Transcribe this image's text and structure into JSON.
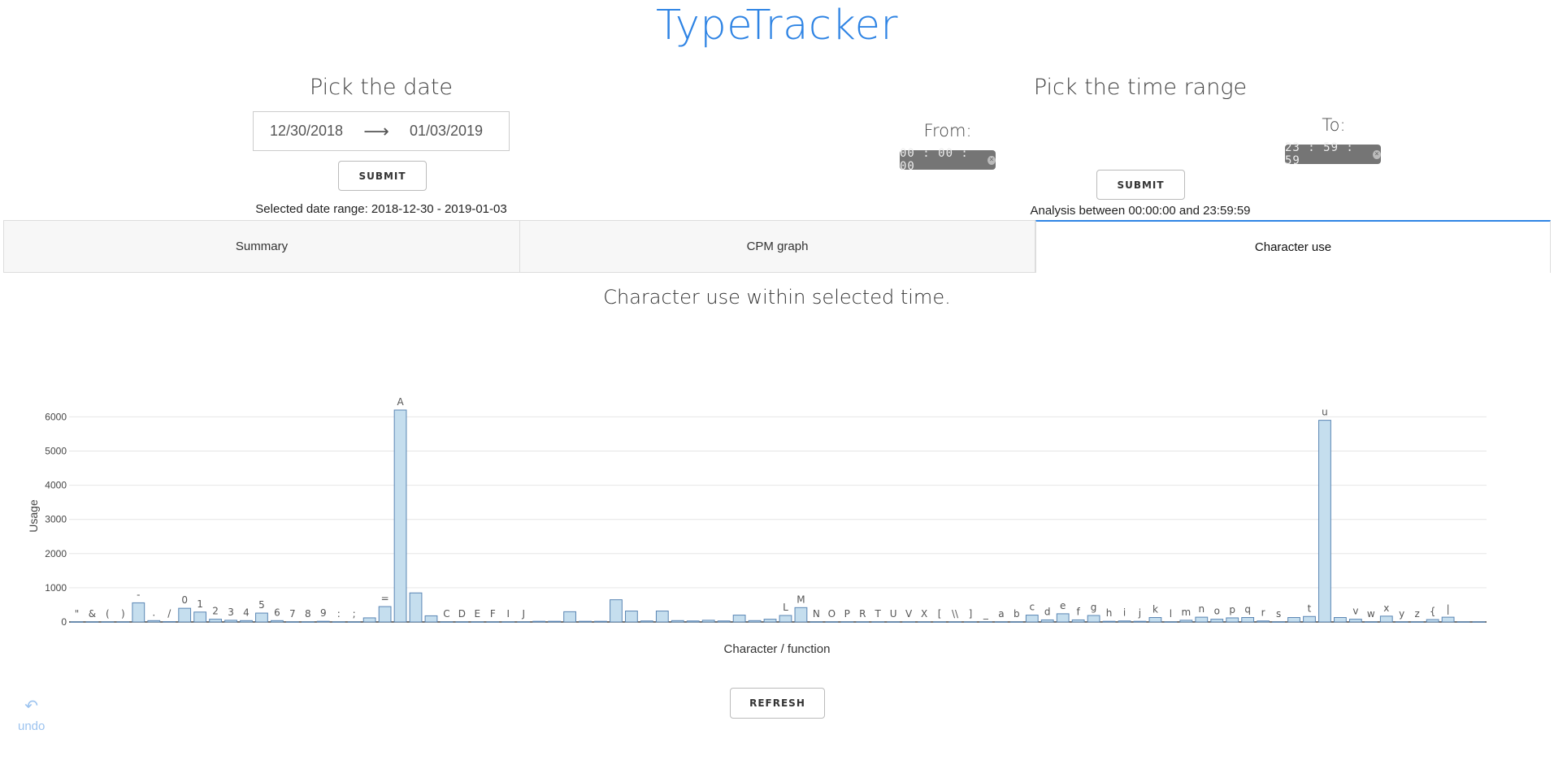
{
  "app": {
    "title": "TypeTracker"
  },
  "date_picker": {
    "heading": "Pick the date",
    "start": "12/30/2018",
    "arrow": "⟶",
    "end": "01/03/2019",
    "submit_label": "SUBMIT",
    "selected_text": "Selected date range: 2018-12-30 - 2019-01-03"
  },
  "time_picker": {
    "heading": "Pick the time range",
    "from_label": "From:",
    "from_value": "00 : 00 : 00",
    "to_label": "To:",
    "to_value": "23 : 59 : 59",
    "clear_icon": "×",
    "submit_label": "SUBMIT",
    "analysis_text": "Analysis between 00:00:00 and 23:59:59"
  },
  "tabs": [
    {
      "label": "Summary",
      "active": false
    },
    {
      "label": "CPM graph",
      "active": false
    },
    {
      "label": "Character use",
      "active": true
    }
  ],
  "refresh_label": "REFRESH",
  "undo": {
    "icon": "undo-icon",
    "glyph": "↶",
    "label": "undo"
  },
  "colors": {
    "accent": "#2f84e4",
    "bar_fill": "#c5deee",
    "bar_stroke": "#5a86b4"
  },
  "chart_data": {
    "type": "bar",
    "title": "Character use within selected time.",
    "xlabel": "Character / function",
    "ylabel": "Usage",
    "ylim": [
      0,
      6200
    ],
    "yticks": [
      0,
      1000,
      2000,
      3000,
      4000,
      5000,
      6000
    ],
    "grid": true,
    "categories": [
      "\"",
      "&",
      "(",
      ")",
      "-",
      ".",
      "/",
      "0",
      "1",
      "2",
      "3",
      "4",
      "5",
      "6",
      "7",
      "8",
      "9",
      ":",
      ";",
      "",
      "=",
      "A",
      "",
      "",
      "C",
      "D",
      "E",
      "F",
      "I",
      "J",
      "",
      "",
      "",
      "",
      "",
      "",
      "",
      "",
      "",
      "",
      "",
      "",
      "",
      "",
      "",
      "",
      "L",
      "M",
      "N",
      "O",
      "P",
      "R",
      "T",
      "U",
      "V",
      "X",
      "[",
      "\\\\",
      "]",
      "_",
      "a",
      "b",
      "c",
      "d",
      "e",
      "f",
      "g",
      "h",
      "i",
      "j",
      "k",
      "l",
      "m",
      "n",
      "o",
      "p",
      "q",
      "r",
      "s",
      "",
      "t",
      "u",
      "",
      "v",
      "w",
      "x",
      "y",
      "z",
      "{",
      "|"
    ],
    "values": [
      5,
      5,
      5,
      5,
      560,
      40,
      10,
      400,
      290,
      80,
      50,
      40,
      260,
      40,
      5,
      5,
      20,
      5,
      5,
      120,
      450,
      6200,
      850,
      180,
      5,
      5,
      5,
      5,
      5,
      5,
      20,
      20,
      300,
      20,
      20,
      650,
      320,
      30,
      320,
      40,
      30,
      50,
      30,
      200,
      40,
      80,
      190,
      420,
      5,
      5,
      5,
      5,
      5,
      5,
      5,
      5,
      5,
      5,
      5,
      5,
      5,
      5,
      200,
      60,
      240,
      60,
      190,
      20,
      30,
      20,
      130,
      5,
      50,
      140,
      80,
      120,
      130,
      30,
      5,
      130,
      160,
      5900,
      130,
      80,
      5,
      170,
      5,
      5,
      70,
      140,
      5,
      5
    ]
  }
}
